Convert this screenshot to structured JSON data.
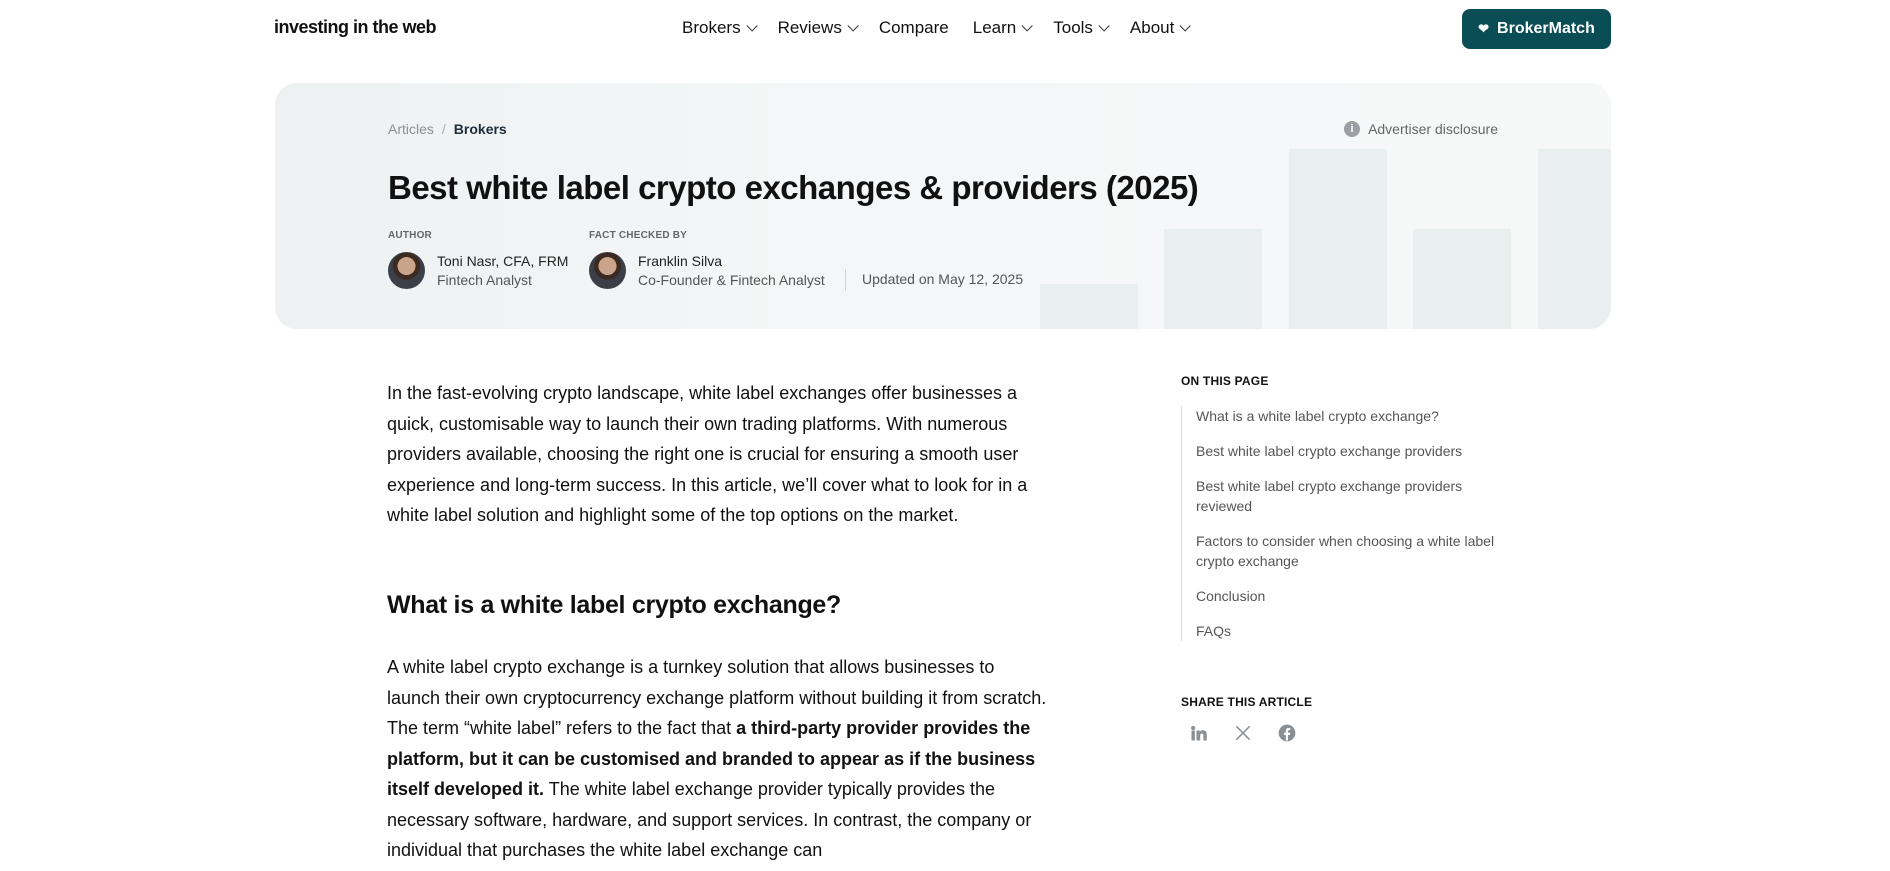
{
  "nav": {
    "logo": "investing in the web",
    "items": [
      {
        "label": "Brokers",
        "has_dropdown": true
      },
      {
        "label": "Reviews",
        "has_dropdown": true
      },
      {
        "label": "Compare",
        "has_dropdown": false
      },
      {
        "label": "Learn",
        "has_dropdown": true
      },
      {
        "label": "Tools",
        "has_dropdown": true
      },
      {
        "label": "About",
        "has_dropdown": true
      }
    ],
    "cta_label": "BrokerMatch"
  },
  "hero": {
    "breadcrumb": [
      "Articles",
      "Brokers"
    ],
    "breadcrumb_separator": "/",
    "disclosure": "Advertiser disclosure",
    "title": "Best white label crypto exchanges & providers (2025)",
    "author_label": "AUTHOR",
    "author_name": "Toni Nasr, CFA, FRM",
    "author_role": "Fintech Analyst",
    "checker_label": "FACT CHECKED BY",
    "checker_name": "Franklin Silva",
    "checker_role": "Co-Founder & Fintech Analyst",
    "updated": "Updated on May 12, 2025"
  },
  "article": {
    "intro": "In the fast-evolving crypto landscape, white label exchanges offer businesses a quick, customisable way to launch their own trading platforms. With numerous providers available, choosing the right one is crucial for ensuring a smooth user experience and long-term success. In this article, we’ll cover what to look for in a white label solution and highlight some of the top options on the market.",
    "h2": "What is a white label crypto exchange?",
    "p2_a": "A white label crypto exchange is a turnkey solution that allows businesses to launch their own cryptocurrency exchange platform without building it from scratch. The term “white label” refers to the fact that ",
    "p2_bold": "a third-party provider provides the platform, but it can be customised and branded to appear as if the business itself developed it.",
    "p2_b": " The white label exchange provider typically provides the necessary software, hardware, and support services. In contrast, the company or individual that purchases the white label exchange can"
  },
  "sidebar": {
    "toc_title": "ON THIS PAGE",
    "toc": [
      "What is a white label crypto exchange?",
      "Best white label crypto exchange providers",
      "Best white label crypto exchange providers reviewed",
      "Factors to consider when choosing a white label crypto exchange",
      "Conclusion",
      "FAQs"
    ],
    "share_title": "SHARE THIS ARTICLE",
    "share_icons": [
      "linkedin-icon",
      "x-icon",
      "facebook-icon"
    ]
  },
  "colors": {
    "cta": "#0b4d55",
    "hero_bg": "#f4f6f7"
  }
}
